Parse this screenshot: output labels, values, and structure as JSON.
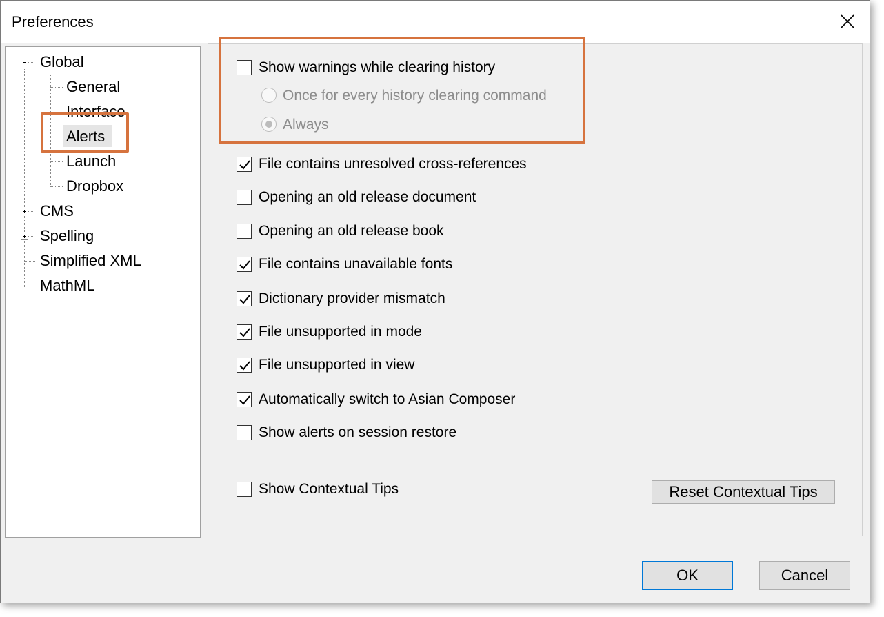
{
  "window": {
    "title": "Preferences"
  },
  "tree": {
    "items": [
      {
        "label": "Global"
      },
      {
        "label": "General"
      },
      {
        "label": "Interface"
      },
      {
        "label": "Alerts"
      },
      {
        "label": "Launch"
      },
      {
        "label": "Dropbox"
      },
      {
        "label": "CMS"
      },
      {
        "label": "Spelling"
      },
      {
        "label": "Simplified XML"
      },
      {
        "label": "MathML"
      }
    ],
    "selected": "Alerts"
  },
  "history": {
    "show_warnings": {
      "label": "Show warnings while clearing history",
      "checked": false
    },
    "radio_once": {
      "label": "Once for every history clearing command",
      "checked": false,
      "disabled": true
    },
    "radio_always": {
      "label": "Always",
      "checked": true,
      "disabled": true
    }
  },
  "alerts": [
    {
      "label": "File contains unresolved cross-references",
      "checked": true
    },
    {
      "label": "Opening an old release document",
      "checked": false
    },
    {
      "label": "Opening an old release book",
      "checked": false
    },
    {
      "label": "File contains unavailable fonts",
      "checked": true
    },
    {
      "label": "Dictionary provider mismatch",
      "checked": true
    },
    {
      "label": "File unsupported in mode",
      "checked": true
    },
    {
      "label": "File unsupported in view",
      "checked": true
    },
    {
      "label": "Automatically switch to Asian Composer",
      "checked": true
    },
    {
      "label": "Show alerts on session restore",
      "checked": false
    }
  ],
  "tips": {
    "show_label": "Show Contextual Tips",
    "checked": false,
    "reset_label": "Reset Contextual Tips"
  },
  "footer": {
    "ok_label": "OK",
    "cancel_label": "Cancel"
  },
  "colors": {
    "highlight": "#d6733e",
    "default_button_border": "#0078d7"
  }
}
